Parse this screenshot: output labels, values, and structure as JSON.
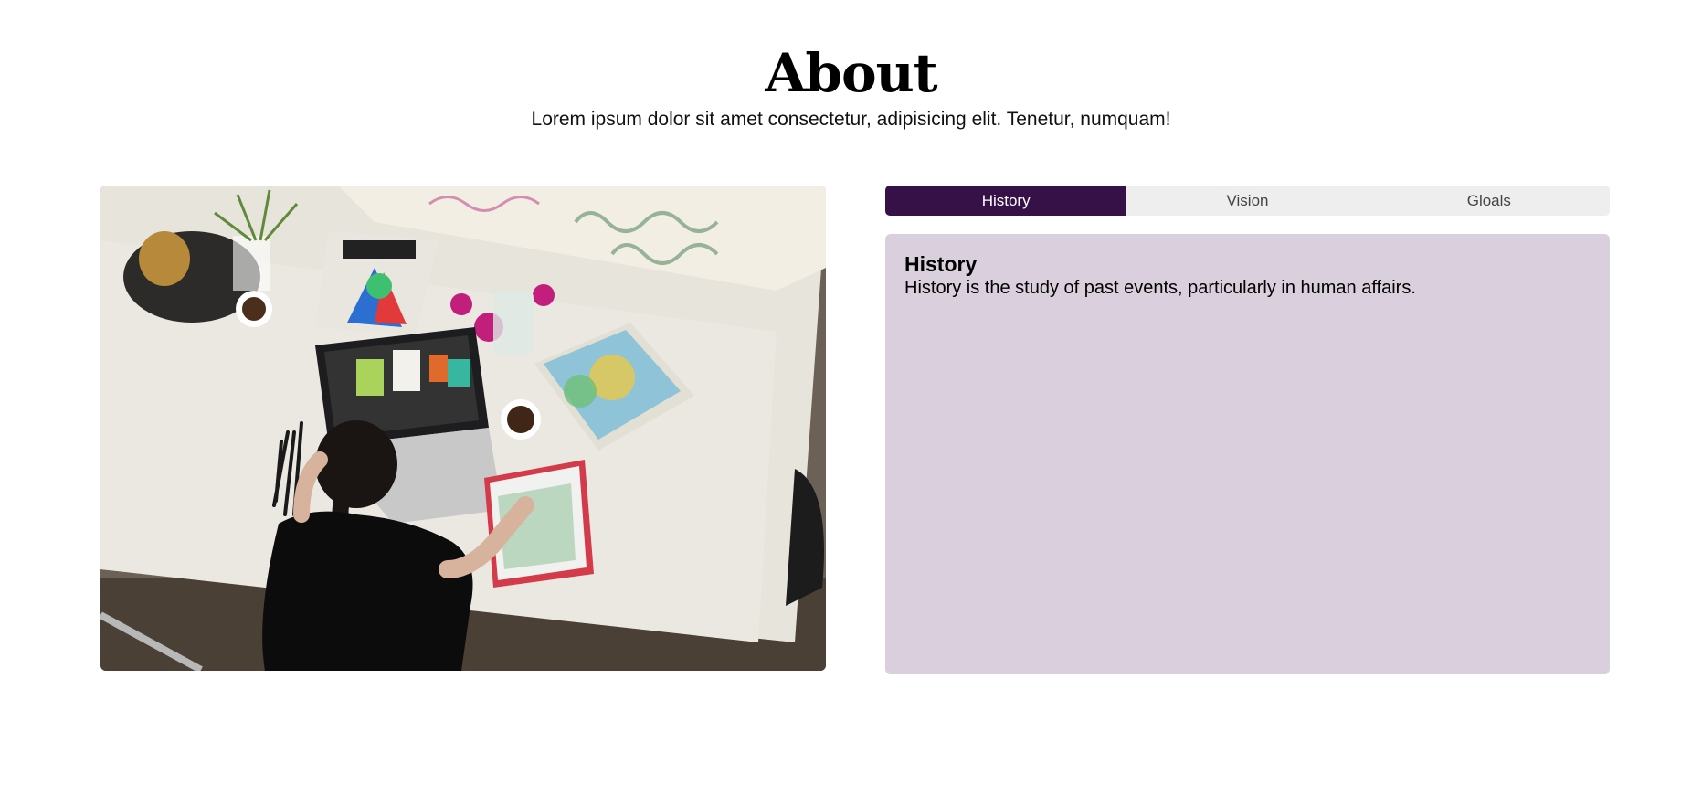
{
  "header": {
    "title": "About",
    "subtitle": "Lorem ipsum dolor sit amet consectetur, adipisicing elit. Tenetur, numquam!"
  },
  "photo": {
    "icon": "workspace-photo"
  },
  "tabs": [
    {
      "label": "History",
      "active": true
    },
    {
      "label": "Vision",
      "active": false
    },
    {
      "label": "Gloals",
      "active": false
    }
  ],
  "panel": {
    "heading": "History",
    "body": "History is the study of past events, particularly in human affairs."
  },
  "colors": {
    "tab_active": "#351148",
    "tab_inactive": "#eeeeee",
    "panel_bg": "#d9cfdd"
  }
}
